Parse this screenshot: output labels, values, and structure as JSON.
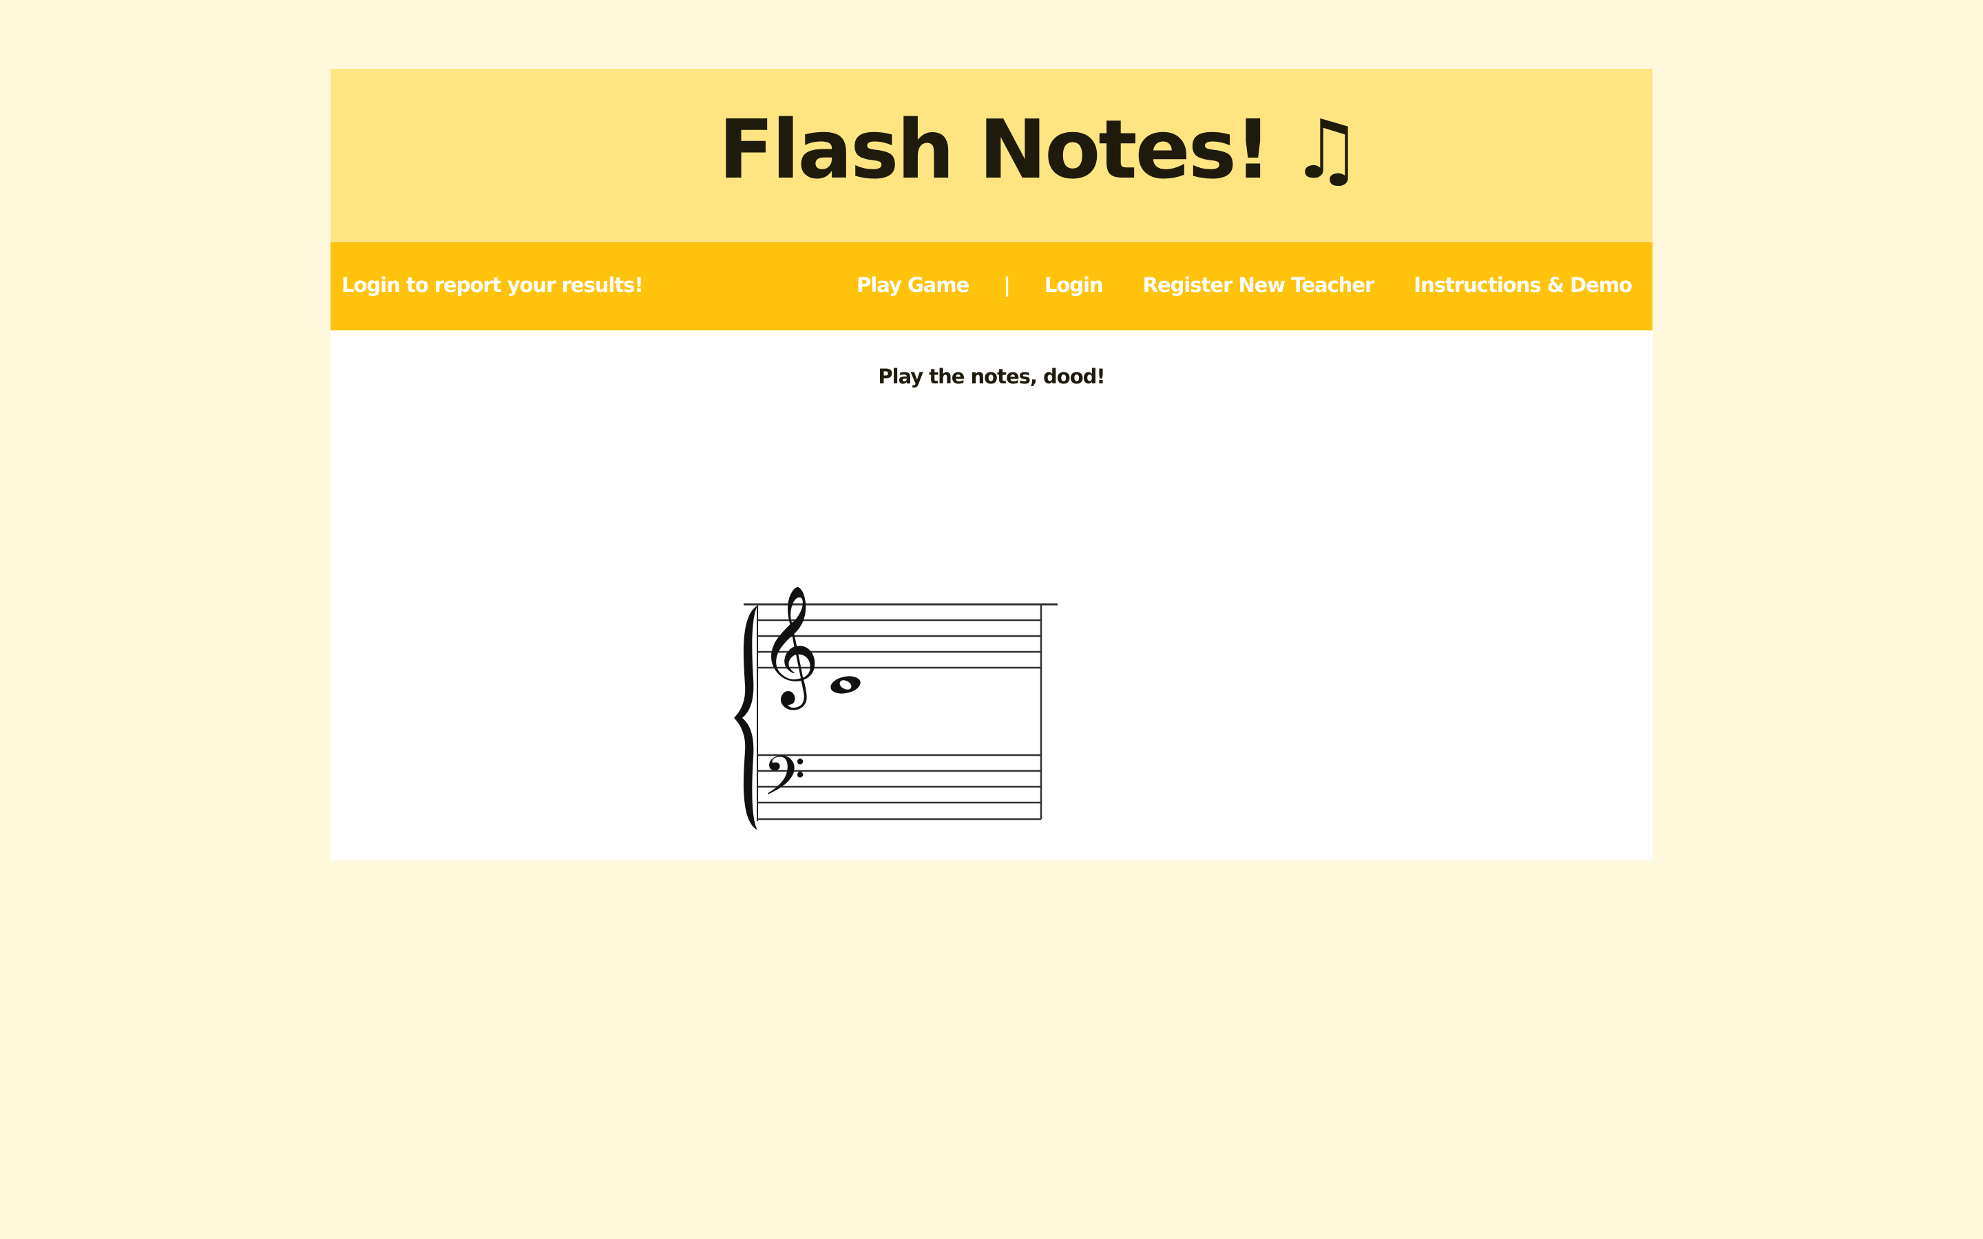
{
  "header": {
    "title": "Flash Notes!",
    "title_icon": "♫"
  },
  "navbar": {
    "login_prompt": "Login to report your results!",
    "items": [
      {
        "label": "Play Game"
      },
      {
        "separator": "|"
      },
      {
        "label": "Login"
      },
      {
        "label": "Register New Teacher"
      },
      {
        "label": "Instructions & Demo"
      }
    ]
  },
  "main": {
    "prompt": "Play the notes, dood!",
    "staff": {
      "clefs": [
        "treble-clef",
        "bass-clef"
      ],
      "note": "whole-note"
    }
  },
  "colors": {
    "page_background": "#fff8dd",
    "banner": "#ffe582",
    "navbar": "#ffc30d",
    "text_dark": "#1e1a0c",
    "nav_text": "#ffffff"
  }
}
